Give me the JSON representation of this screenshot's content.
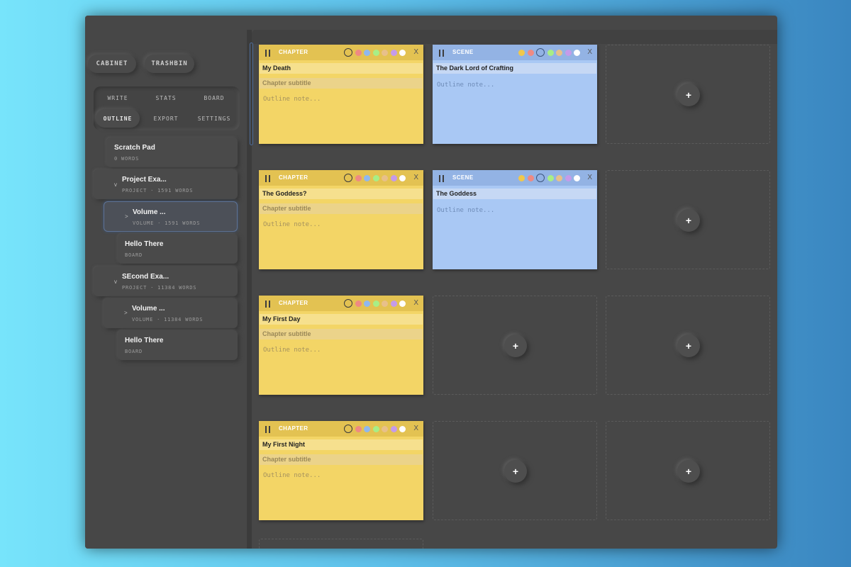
{
  "top_buttons": {
    "cabinet": "CABINET",
    "trashbin": "TRASHBIN"
  },
  "nav": {
    "write": "WRITE",
    "stats": "STATS",
    "board": "BOARD",
    "outline": "OUTLINE",
    "export": "EXPORT",
    "settings": "SETTINGS",
    "active": "OUTLINE"
  },
  "tree": [
    {
      "title": "Scratch Pad",
      "meta": "0 WORDS"
    },
    {
      "title": "Project Exa...",
      "meta": "PROJECT · 1591 WORDS",
      "chevron": "v"
    },
    {
      "title": "Volume ...",
      "meta": "VOLUME · 1591 WORDS",
      "chevron": ">",
      "selected": true
    },
    {
      "title": "Hello There",
      "meta": "BOARD"
    },
    {
      "title": "SEcond Exa...",
      "meta": "PROJECT · 11384 WORDS",
      "chevron": "v"
    },
    {
      "title": "Volume ...",
      "meta": "VOLUME · 11384 WORDS",
      "chevron": ">"
    },
    {
      "title": "Hello There",
      "meta": "BOARD"
    }
  ],
  "palette": [
    "#f1c84b",
    "#ef8a83",
    "#8fb8ef",
    "#a8ee86",
    "#e8c08a",
    "#c59bea",
    "#ffffff"
  ],
  "cards": [
    {
      "type": "CHAPTER",
      "color": "yellow",
      "title": "My Death",
      "subtitle_placeholder": "Chapter subtitle",
      "note_placeholder": "Outline note...",
      "selected_color": 0
    },
    {
      "type": "SCENE",
      "color": "blue",
      "title": "The Dark Lord of Crafting",
      "note_placeholder": "Outline note...",
      "selected_color": 2
    },
    {
      "type": "CHAPTER",
      "color": "yellow",
      "title": "The Goddess?",
      "subtitle_placeholder": "Chapter subtitle",
      "note_placeholder": "Outline note...",
      "selected_color": 0
    },
    {
      "type": "SCENE",
      "color": "blue",
      "title": "The Goddess",
      "note_placeholder": "Outline note...",
      "selected_color": 2
    },
    {
      "type": "CHAPTER",
      "color": "yellow",
      "title": "My First Day",
      "subtitle_placeholder": "Chapter subtitle",
      "note_placeholder": "Outline note...",
      "selected_color": 0
    },
    {
      "type": "CHAPTER",
      "color": "yellow",
      "title": "My First Night",
      "subtitle_placeholder": "Chapter subtitle",
      "note_placeholder": "Outline note...",
      "selected_color": 0
    }
  ],
  "add_label": "+",
  "close_label": "X"
}
